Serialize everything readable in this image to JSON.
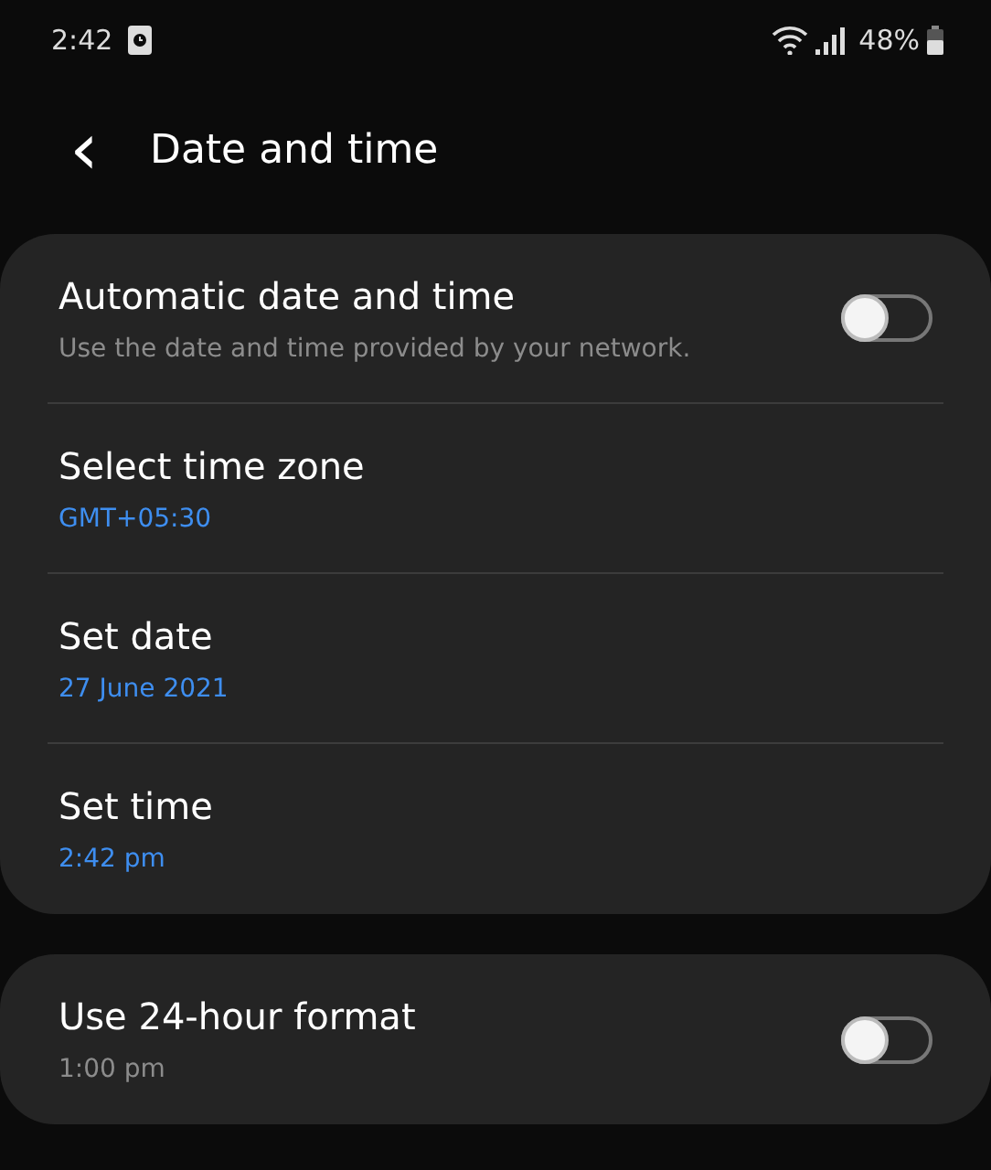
{
  "status_bar": {
    "time": "2:42",
    "battery": "48%"
  },
  "header": {
    "back": "‹",
    "title": "Date and time"
  },
  "groups": [
    {
      "items": [
        {
          "kind": "toggle",
          "title": "Automatic date and time",
          "summary": "Use the date and time provided by your network.",
          "on": false
        },
        {
          "kind": "link",
          "title": "Select time zone",
          "summary": "GMT+05:30"
        },
        {
          "kind": "link",
          "title": "Set date",
          "summary": "27 June 2021"
        },
        {
          "kind": "link",
          "title": "Set time",
          "summary": "2:42 pm"
        }
      ]
    },
    {
      "items": [
        {
          "kind": "toggle",
          "title": "Use 24-hour format",
          "summary": "1:00 pm",
          "on": false
        }
      ]
    }
  ]
}
